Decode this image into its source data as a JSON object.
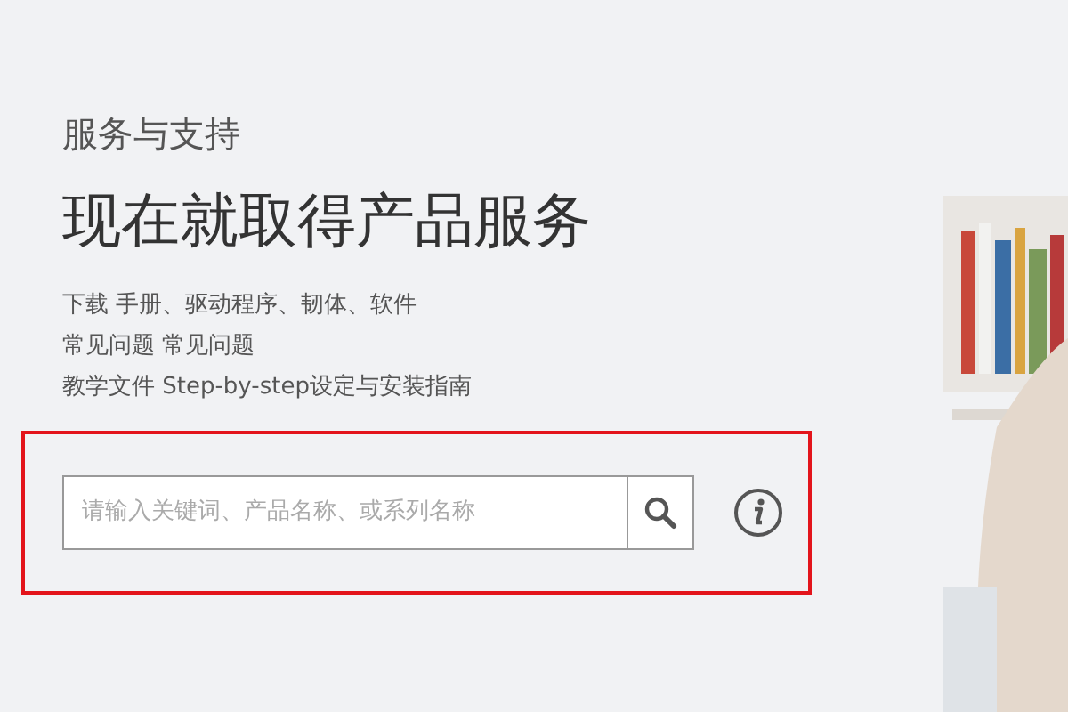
{
  "section_label": "服务与支持",
  "headline": "现在就取得产品服务",
  "links": [
    "下载 手册、驱动程序、韧体、软件",
    "常见问题 常见问题",
    "教学文件 Step-by-step设定与安装指南"
  ],
  "search": {
    "placeholder": "请输入关键词、产品名称、或系列名称",
    "highlighted": true
  }
}
